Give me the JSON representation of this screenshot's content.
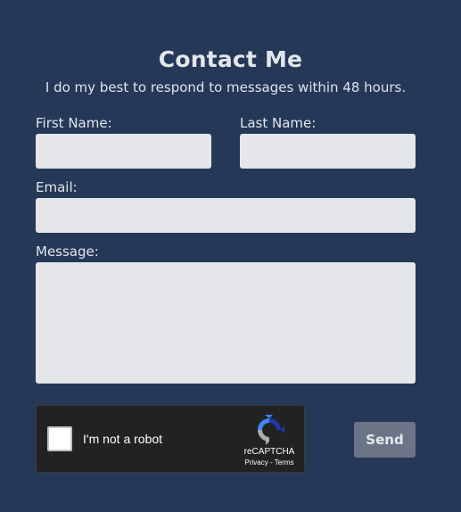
{
  "header": {
    "title": "Contact Me",
    "subtitle": "I do my best to respond to messages within 48 hours."
  },
  "form": {
    "first_name": {
      "label": "First Name:",
      "value": ""
    },
    "last_name": {
      "label": "Last Name:",
      "value": ""
    },
    "email": {
      "label": "Email:",
      "value": ""
    },
    "message": {
      "label": "Message:",
      "value": ""
    },
    "send_label": "Send"
  },
  "captcha": {
    "checkbox_label": "I'm not a robot",
    "brand": "reCAPTCHA",
    "links": "Privacy - Terms",
    "checked": false,
    "logo_icon": "recaptcha-logo-icon"
  },
  "colors": {
    "background": "#253858",
    "field": "#e4e6ea",
    "button": "#6b7587"
  }
}
